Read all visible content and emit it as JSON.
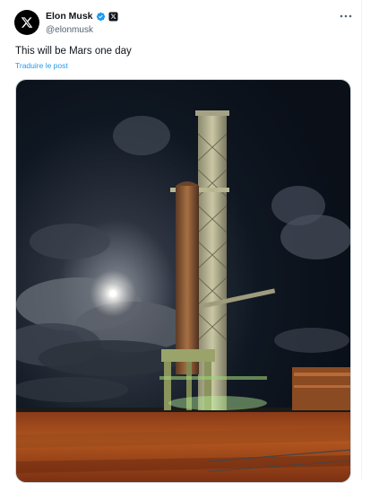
{
  "tweet": {
    "author_name": "Elon Musk",
    "author_handle": "@elonmusk",
    "text": "This will be Mars one day",
    "translate_label": "Traduire le post"
  },
  "icons": {
    "avatar": "x-logo-icon",
    "verified": "verified-badge-icon",
    "affiliation": "x-badge-icon",
    "more": "more-horizontal-icon"
  },
  "colors": {
    "accent": "#1d9bf0",
    "text_primary": "#0f1419",
    "text_secondary": "#536471"
  }
}
